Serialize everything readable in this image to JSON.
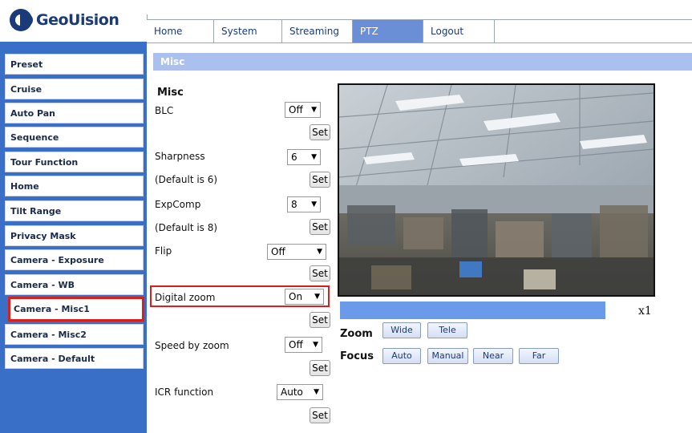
{
  "brand": {
    "name": "GeoUision"
  },
  "tabs": [
    {
      "label": "Home"
    },
    {
      "label": "System"
    },
    {
      "label": "Streaming"
    },
    {
      "label": "PTZ"
    },
    {
      "label": "Logout"
    }
  ],
  "active_tab": "PTZ",
  "sidebar": {
    "items": [
      {
        "label": "Preset"
      },
      {
        "label": "Cruise"
      },
      {
        "label": "Auto Pan"
      },
      {
        "label": "Sequence"
      },
      {
        "label": "Tour Function"
      },
      {
        "label": "Home"
      },
      {
        "label": "Tilt Range"
      },
      {
        "label": "Privacy Mask"
      },
      {
        "label": "Camera - Exposure"
      },
      {
        "label": "Camera - WB"
      },
      {
        "label": "Camera - Misc1"
      },
      {
        "label": "Camera - Misc2"
      },
      {
        "label": "Camera - Default"
      }
    ],
    "selected": "Camera - Misc1"
  },
  "section_title": "Misc",
  "form": {
    "heading": "Misc",
    "set_label": "Set",
    "blc": {
      "label": "BLC",
      "value": "Off"
    },
    "sharpness": {
      "label": "Sharpness",
      "value": "6",
      "default_note": "(Default is 6)"
    },
    "expcomp": {
      "label": "ExpComp",
      "value": "8",
      "default_note": "(Default is 8)"
    },
    "flip": {
      "label": "Flip",
      "value": "Off"
    },
    "digital_zoom": {
      "label": "Digital zoom",
      "value": "On"
    },
    "speed_by_zoom": {
      "label": "Speed by zoom",
      "value": "Off"
    },
    "icr_function": {
      "label": "ICR function",
      "value": "Auto"
    }
  },
  "camera": {
    "zoom_level": "x1",
    "zoom": {
      "label": "Zoom",
      "buttons": [
        "Wide",
        "Tele"
      ]
    },
    "focus": {
      "label": "Focus",
      "buttons": [
        "Auto",
        "Manual",
        "Near",
        "Far"
      ]
    }
  },
  "colors": {
    "sidebar_bg": "#3a6fc8",
    "section_bar": "#aac1f0",
    "active_tab": "#6b8fd6",
    "highlight": "#d9201a",
    "zoom_bar": "#6b9be8"
  }
}
